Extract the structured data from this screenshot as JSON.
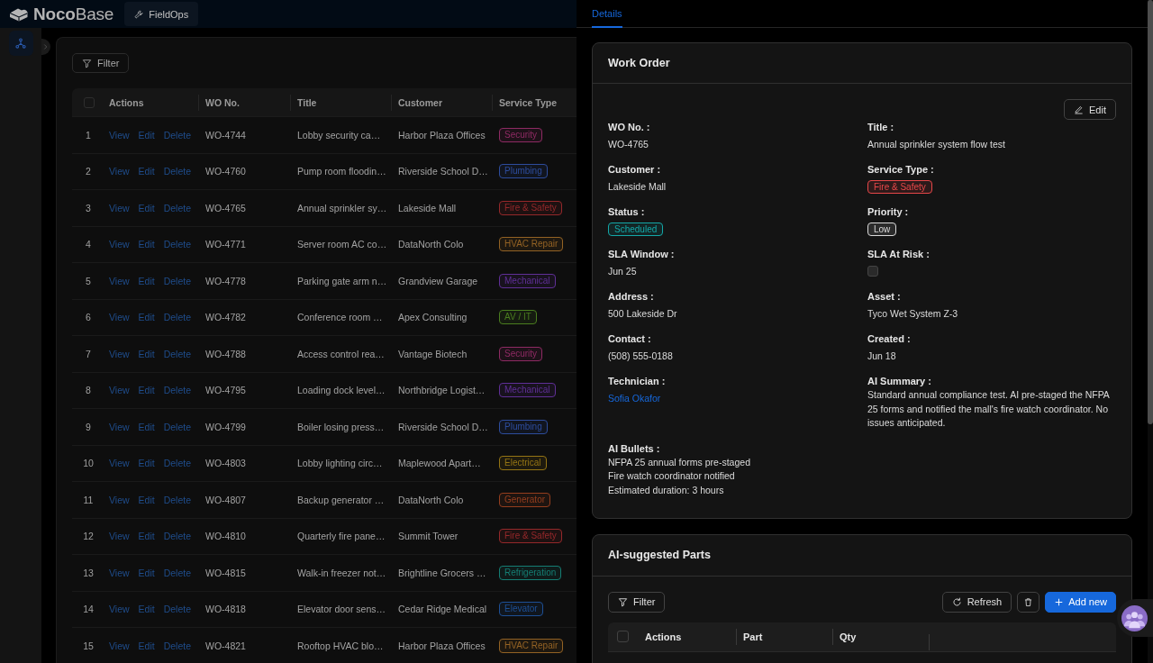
{
  "header": {
    "logo": "**Noco**Base",
    "tabs": [
      {
        "label": "FieldOps",
        "selected": true
      }
    ]
  },
  "sidebar": {
    "items": [
      {
        "selected": true
      }
    ]
  },
  "work_orders": {
    "filter_button": "Filter",
    "select_all": {
      "checked": false
    },
    "columns": [
      "Actions",
      "WO No.",
      "Title",
      "Customer",
      "Service Type"
    ],
    "rows": [
      {
        "index": "1",
        "actions": [
          "View",
          "Edit",
          "Delete"
        ],
        "wo_no": "WO-4744",
        "title": "Lobby security ca…",
        "customer": "Harbor Plaza Offices",
        "service_type": {
          "label": "Security",
          "color": "#8e2a63"
        }
      },
      {
        "index": "2",
        "actions": [
          "View",
          "Edit",
          "Delete"
        ],
        "wo_no": "WO-4760",
        "title": "Pump room floodin…",
        "customer": "Riverside School D…",
        "service_type": {
          "label": "Plumbing",
          "color": "#2d4c9c"
        }
      },
      {
        "index": "3",
        "actions": [
          "View",
          "Edit",
          "Delete"
        ],
        "wo_no": "WO-4765",
        "title": "Annual sprinkler sy…",
        "customer": "Lakeside Mall",
        "service_type": {
          "label": "Fire & Safety",
          "color": "#94282a"
        }
      },
      {
        "index": "4",
        "actions": [
          "View",
          "Edit",
          "Delete"
        ],
        "wo_no": "WO-4771",
        "title": "Server room AC co…",
        "customer": "DataNorth Colo",
        "service_type": {
          "label": "HVAC Repair",
          "color": "#936224"
        }
      },
      {
        "index": "5",
        "actions": [
          "View",
          "Edit",
          "Delete"
        ],
        "wo_no": "WO-4778",
        "title": "Parking gate arm n…",
        "customer": "Grandview Garage",
        "service_type": {
          "label": "Mechanical",
          "color": "#5f2f96"
        }
      },
      {
        "index": "6",
        "actions": [
          "View",
          "Edit",
          "Delete"
        ],
        "wo_no": "WO-4782",
        "title": "Conference room …",
        "customer": "Apex Consulting",
        "service_type": {
          "label": "AV / IT",
          "color": "#4a7d1f"
        }
      },
      {
        "index": "7",
        "actions": [
          "View",
          "Edit",
          "Delete"
        ],
        "wo_no": "WO-4788",
        "title": "Access control rea…",
        "customer": "Vantage Biotech",
        "service_type": {
          "label": "Security",
          "color": "#8e2a63"
        }
      },
      {
        "index": "8",
        "actions": [
          "View",
          "Edit",
          "Delete"
        ],
        "wo_no": "WO-4795",
        "title": "Loading dock level…",
        "customer": "Northbridge Logist…",
        "service_type": {
          "label": "Mechanical",
          "color": "#5f2f96"
        }
      },
      {
        "index": "9",
        "actions": [
          "View",
          "Edit",
          "Delete"
        ],
        "wo_no": "WO-4799",
        "title": "Boiler losing press…",
        "customer": "Riverside School D…",
        "service_type": {
          "label": "Plumbing",
          "color": "#2d4c9c"
        }
      },
      {
        "index": "10",
        "actions": [
          "View",
          "Edit",
          "Delete"
        ],
        "wo_no": "WO-4803",
        "title": "Lobby lighting circ…",
        "customer": "Maplewood Apart…",
        "service_type": {
          "label": "Electrical",
          "color": "#947414"
        }
      },
      {
        "index": "11",
        "actions": [
          "View",
          "Edit",
          "Delete"
        ],
        "wo_no": "WO-4807",
        "title": "Backup generator …",
        "customer": "DataNorth Colo",
        "service_type": {
          "label": "Generator",
          "color": "#943e1e"
        }
      },
      {
        "index": "12",
        "actions": [
          "View",
          "Edit",
          "Delete"
        ],
        "wo_no": "WO-4810",
        "title": "Quarterly fire pane…",
        "customer": "Summit Tower",
        "service_type": {
          "label": "Fire & Safety",
          "color": "#94282a"
        }
      },
      {
        "index": "13",
        "actions": [
          "View",
          "Edit",
          "Delete"
        ],
        "wo_no": "WO-4815",
        "title": "Walk-in freezer not…",
        "customer": "Brightline Grocers …",
        "service_type": {
          "label": "Refrigeration",
          "color": "#157d73"
        }
      },
      {
        "index": "14",
        "actions": [
          "View",
          "Edit",
          "Delete"
        ],
        "wo_no": "WO-4818",
        "title": "Elevator door sens…",
        "customer": "Cedar Ridge Medical",
        "service_type": {
          "label": "Elevator",
          "color": "#1d4f95"
        }
      },
      {
        "index": "15",
        "actions": [
          "View",
          "Edit",
          "Delete"
        ],
        "wo_no": "WO-4821",
        "title": "Rooftop HVAC blo…",
        "customer": "Harbor Plaza Offices",
        "service_type": {
          "label": "HVAC Repair",
          "color": "#936224"
        }
      }
    ]
  },
  "drawer": {
    "tabs": [
      {
        "label": "Details",
        "selected": true
      }
    ],
    "work_order": {
      "title": "Work Order",
      "edit_button": "Edit",
      "fields": [
        {
          "label": "WO No. :",
          "kind": "text",
          "value": "WO-4765"
        },
        {
          "label": "Title :",
          "kind": "text",
          "value": "Annual sprinkler system flow test"
        },
        {
          "label": "Customer :",
          "kind": "text",
          "value": "Lakeside Mall"
        },
        {
          "label": "Service Type :",
          "kind": "tag",
          "value": "Fire & Safety",
          "color": "#e84749"
        },
        {
          "label": "Status :",
          "kind": "tag",
          "value": "Scheduled",
          "color": "#13a8a8"
        },
        {
          "label": "Priority :",
          "kind": "tag",
          "value": "Low",
          "color": "#d9d9d9"
        },
        {
          "label": "SLA Window :",
          "kind": "text",
          "value": "Jun 25"
        },
        {
          "label": "SLA At Risk :",
          "kind": "checkbox",
          "checked": false
        },
        {
          "label": "Address :",
          "kind": "text",
          "value": "500 Lakeside Dr"
        },
        {
          "label": "Asset :",
          "kind": "text",
          "value": "Tyco Wet System Z-3"
        },
        {
          "label": "Contact :",
          "kind": "text",
          "value": "(508) 555-0188"
        },
        {
          "label": "Created :",
          "kind": "text",
          "value": "Jun 18"
        },
        {
          "label": "Technician :",
          "kind": "link",
          "value": "Sofia Okafor"
        },
        {
          "label": "AI Summary :",
          "kind": "paragraph",
          "value": "Standard annual compliance test. AI pre-staged the NFPA 25 forms and notified the mall's fire watch coordinator. No issues anticipated."
        },
        {
          "label": "AI Bullets :",
          "kind": "lines",
          "lines": [
            "NFPA 25 annual forms pre-staged",
            "Fire watch coordinator notified",
            "Estimated duration: 3 hours"
          ]
        }
      ]
    },
    "parts": {
      "title": "AI-suggested Parts",
      "filter_button": "Filter",
      "refresh_button": "Refresh",
      "add_button": "Add new",
      "select_all": {
        "checked": false
      },
      "columns": [
        "Actions",
        "Part",
        "Qty"
      ]
    }
  }
}
